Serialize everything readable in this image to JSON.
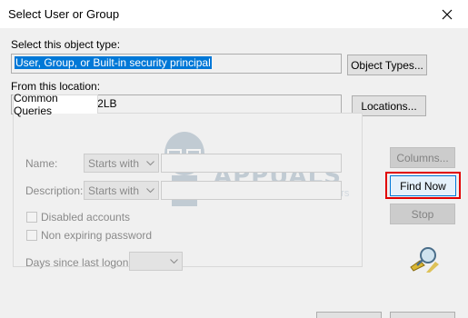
{
  "window": {
    "title": "Select User or Group"
  },
  "object_type": {
    "label": "Select this object type:",
    "value": "User, Group, or Built-in security principal",
    "button": "Object Types..."
  },
  "location": {
    "label": "From this location:",
    "value": "DESKTOP-E50U2LB",
    "button": "Locations..."
  },
  "queries": {
    "tab": "Common Queries",
    "name_label": "Name:",
    "name_mode": "Starts with",
    "description_label": "Description:",
    "description_mode": "Starts with",
    "disabled_accounts": "Disabled accounts",
    "non_expiring": "Non expiring password",
    "days_label": "Days since last logon:"
  },
  "buttons": {
    "columns": "Columns...",
    "find_now": "Find Now",
    "stop": "Stop"
  },
  "watermark": {
    "brand": "APPUALS",
    "tagline": "TECH HOW-TO'S FROM THE EXPERTS"
  },
  "colors": {
    "selection": "#0078d7",
    "highlight": "#e10000"
  }
}
